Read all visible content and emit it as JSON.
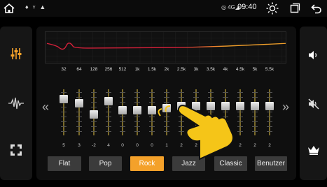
{
  "status_bar": {
    "notification_icons": "♦ ♆ ▲",
    "signal_text": "◎ 4G◢",
    "time": "09:40"
  },
  "left_panel": {
    "items": [
      {
        "icon": "equalizer-icon",
        "active": true
      },
      {
        "icon": "waveform-icon",
        "active": false
      },
      {
        "icon": "speaker-position-icon",
        "active": false
      }
    ]
  },
  "right_panel": {
    "items": [
      {
        "icon": "volume-icon"
      },
      {
        "icon": "mute-icon"
      },
      {
        "icon": "crown-icon"
      }
    ]
  },
  "equalizer": {
    "bands": [
      {
        "freq": "32",
        "value": "5"
      },
      {
        "freq": "64",
        "value": "3"
      },
      {
        "freq": "128",
        "value": "-2"
      },
      {
        "freq": "256",
        "value": "4"
      },
      {
        "freq": "512",
        "value": "0"
      },
      {
        "freq": "1k",
        "value": "0"
      },
      {
        "freq": "1.5k",
        "value": "0"
      },
      {
        "freq": "2k",
        "value": "1"
      },
      {
        "freq": "2.5k",
        "value": "2"
      },
      {
        "freq": "3k",
        "value": "2"
      },
      {
        "freq": "3.5k",
        "value": "2"
      },
      {
        "freq": "4k",
        "value": "2"
      },
      {
        "freq": "4.5k",
        "value": "2"
      },
      {
        "freq": "5k",
        "value": "2"
      },
      {
        "freq": "5.5k",
        "value": "2"
      }
    ],
    "prev_arrow": "«",
    "next_arrow": "»"
  },
  "presets": [
    {
      "label": "Flat",
      "active": false
    },
    {
      "label": "Pop",
      "active": false
    },
    {
      "label": "Rock",
      "active": true
    },
    {
      "label": "Jazz",
      "active": false
    },
    {
      "label": "Classic",
      "active": false
    },
    {
      "label": "Benutzer",
      "active": false
    }
  ],
  "colors": {
    "accent": "#f4a12a",
    "curve_low": "#d8203a",
    "curve_high": "#f4a12a",
    "panel": "#161616"
  }
}
